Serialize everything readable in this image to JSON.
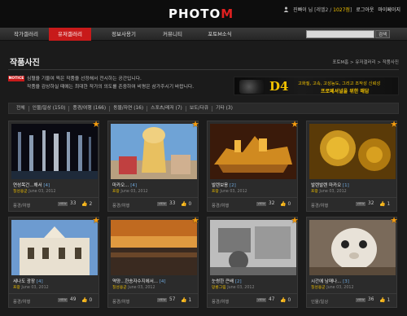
{
  "header": {
    "logo_main": "PHOTO",
    "logo_accent": "M",
    "user_name": "진빠이 님",
    "user_level": "[레벨2 /",
    "user_points": "1027점",
    "user_level_close": "]",
    "logout_label": "로그아웃",
    "mypage_label": "마이페이지"
  },
  "nav": {
    "items": [
      {
        "label": "작가갤러리",
        "active": false
      },
      {
        "label": "유저갤러리",
        "active": true
      },
      {
        "label": "정보사용기",
        "active": false
      },
      {
        "label": "커뮤니티",
        "active": false
      },
      {
        "label": "포토M소식",
        "active": false
      }
    ],
    "search_placeholder": "",
    "search_button": "검색"
  },
  "page": {
    "title": "작품사진",
    "breadcrumb": "포토M홈 > 유저갤러리 > 작품사진",
    "notice_badge": "NOTICE",
    "notice_line1": "심혈을 기울여 찍은 작품을 선정해서 전시하는 공간입니다.",
    "notice_line2": "작품을 감상하실 때에는 최대한 작가의 의도를 존중하여 비평은 삼가주시기 바랍니다."
  },
  "banner": {
    "model": "D4",
    "line1": "고화질, 고속, 고성능도, 그리고 조작성 신뢰성",
    "line2": "프로페셔널을 위한 해답"
  },
  "filter_tabs": [
    "전체",
    "인물/일상 (150)",
    "풍경/여행 (166)",
    "동물/자연 (16)",
    "스포츠/레저 (7)",
    "보도/다큐",
    "기타 (3)"
  ],
  "cards": [
    {
      "title": "연성목건...해서",
      "count": "[4]",
      "author": "칠성용군",
      "date": "June 03, 2012",
      "category": "풍경/여행",
      "views": "33",
      "likes": "2",
      "thumb": "fountain",
      "views_icon": "VIEW"
    },
    {
      "title": "마카오...",
      "count": "[4]",
      "author": "프랑",
      "date": "June 03, 2012",
      "category": "풍경/여행",
      "views": "33",
      "likes": "0",
      "thumb": "tower",
      "views_icon": "VIEW"
    },
    {
      "title": "발렌보옹",
      "count": "[2]",
      "author": "프랑",
      "date": "June 03, 2012",
      "category": "풍경/여행",
      "views": "32",
      "likes": "0",
      "thumb": "ship",
      "views_icon": "VIEW"
    },
    {
      "title": "발렌발렌 마카오",
      "count": "[1]",
      "author": "프랑",
      "date": "June 03, 2012",
      "category": "풍경/여행",
      "views": "32",
      "likes": "1",
      "thumb": "gold",
      "views_icon": "VIEW"
    },
    {
      "title": "세나도 광장",
      "count": "[4]",
      "author": "프랑",
      "date": "June 03, 2012",
      "category": "풍경/여행",
      "views": "49",
      "likes": "0",
      "thumb": "church",
      "views_icon": "VIEW"
    },
    {
      "title": "역양...한송자수지에서...",
      "count": "[4]",
      "author": "칠성용군",
      "date": "June 03, 2012",
      "category": "풍경/여행",
      "views": "57",
      "likes": "1",
      "thumb": "sunset",
      "views_icon": "VIEW"
    },
    {
      "title": "눈썽한 큰배",
      "count": "[2]",
      "author": "망롱그림",
      "date": "June 03, 2012",
      "category": "풍경/여행",
      "views": "47",
      "likes": "0",
      "thumb": "bw",
      "views_icon": "VIEW"
    },
    {
      "title": "시간에 남매나...",
      "count": "[3]",
      "author": "칠성용군",
      "date": "June 03, 2012",
      "category": "인물/일상",
      "views": "36",
      "likes": "1",
      "thumb": "toy",
      "views_icon": "VIEW"
    }
  ],
  "colors": {
    "accent": "#c81a1a",
    "author": "#e6b800",
    "count": "#6fa8dc",
    "star": "#f39c12"
  }
}
